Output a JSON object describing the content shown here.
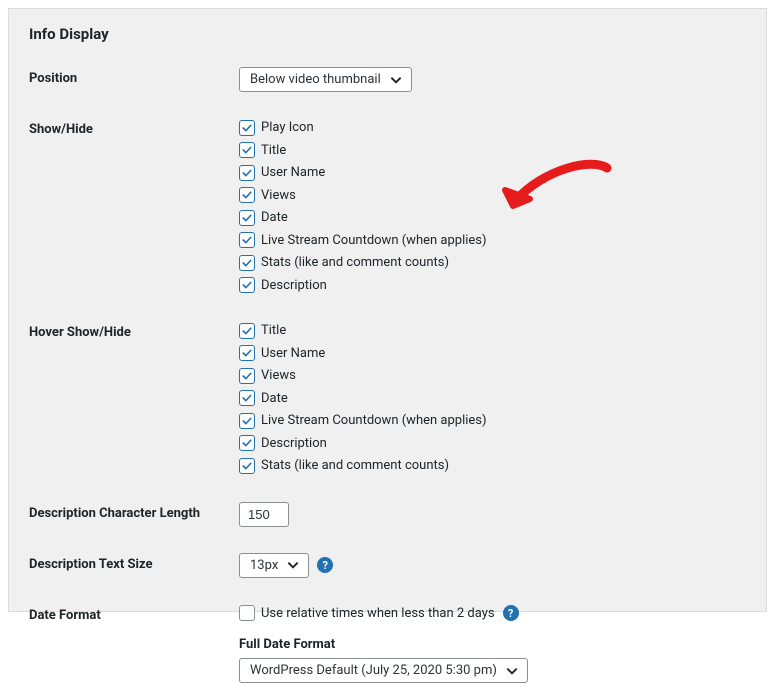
{
  "section_title": "Info Display",
  "position": {
    "label": "Position",
    "selected": "Below video thumbnail"
  },
  "show_hide": {
    "label": "Show/Hide",
    "items": [
      {
        "label": "Play Icon",
        "checked": true
      },
      {
        "label": "Title",
        "checked": true
      },
      {
        "label": "User Name",
        "checked": true
      },
      {
        "label": "Views",
        "checked": true
      },
      {
        "label": "Date",
        "checked": true
      },
      {
        "label": "Live Stream Countdown (when applies)",
        "checked": true
      },
      {
        "label": "Stats (like and comment counts)",
        "checked": true
      },
      {
        "label": "Description",
        "checked": true
      }
    ]
  },
  "hover_show_hide": {
    "label": "Hover Show/Hide",
    "items": [
      {
        "label": "Title",
        "checked": true
      },
      {
        "label": "User Name",
        "checked": true
      },
      {
        "label": "Views",
        "checked": true
      },
      {
        "label": "Date",
        "checked": true
      },
      {
        "label": "Live Stream Countdown (when applies)",
        "checked": true
      },
      {
        "label": "Description",
        "checked": true
      },
      {
        "label": "Stats (like and comment counts)",
        "checked": true
      }
    ]
  },
  "desc_char_length": {
    "label": "Description Character Length",
    "value": "150"
  },
  "desc_text_size": {
    "label": "Description Text Size",
    "selected": "13px"
  },
  "date_format": {
    "label": "Date Format",
    "relative_label": "Use relative times when less than 2 days",
    "relative_checked": false,
    "full_label": "Full Date Format",
    "full_selected": "WordPress Default (July 25, 2020 5:30 pm)"
  },
  "help_icon_text": "?"
}
